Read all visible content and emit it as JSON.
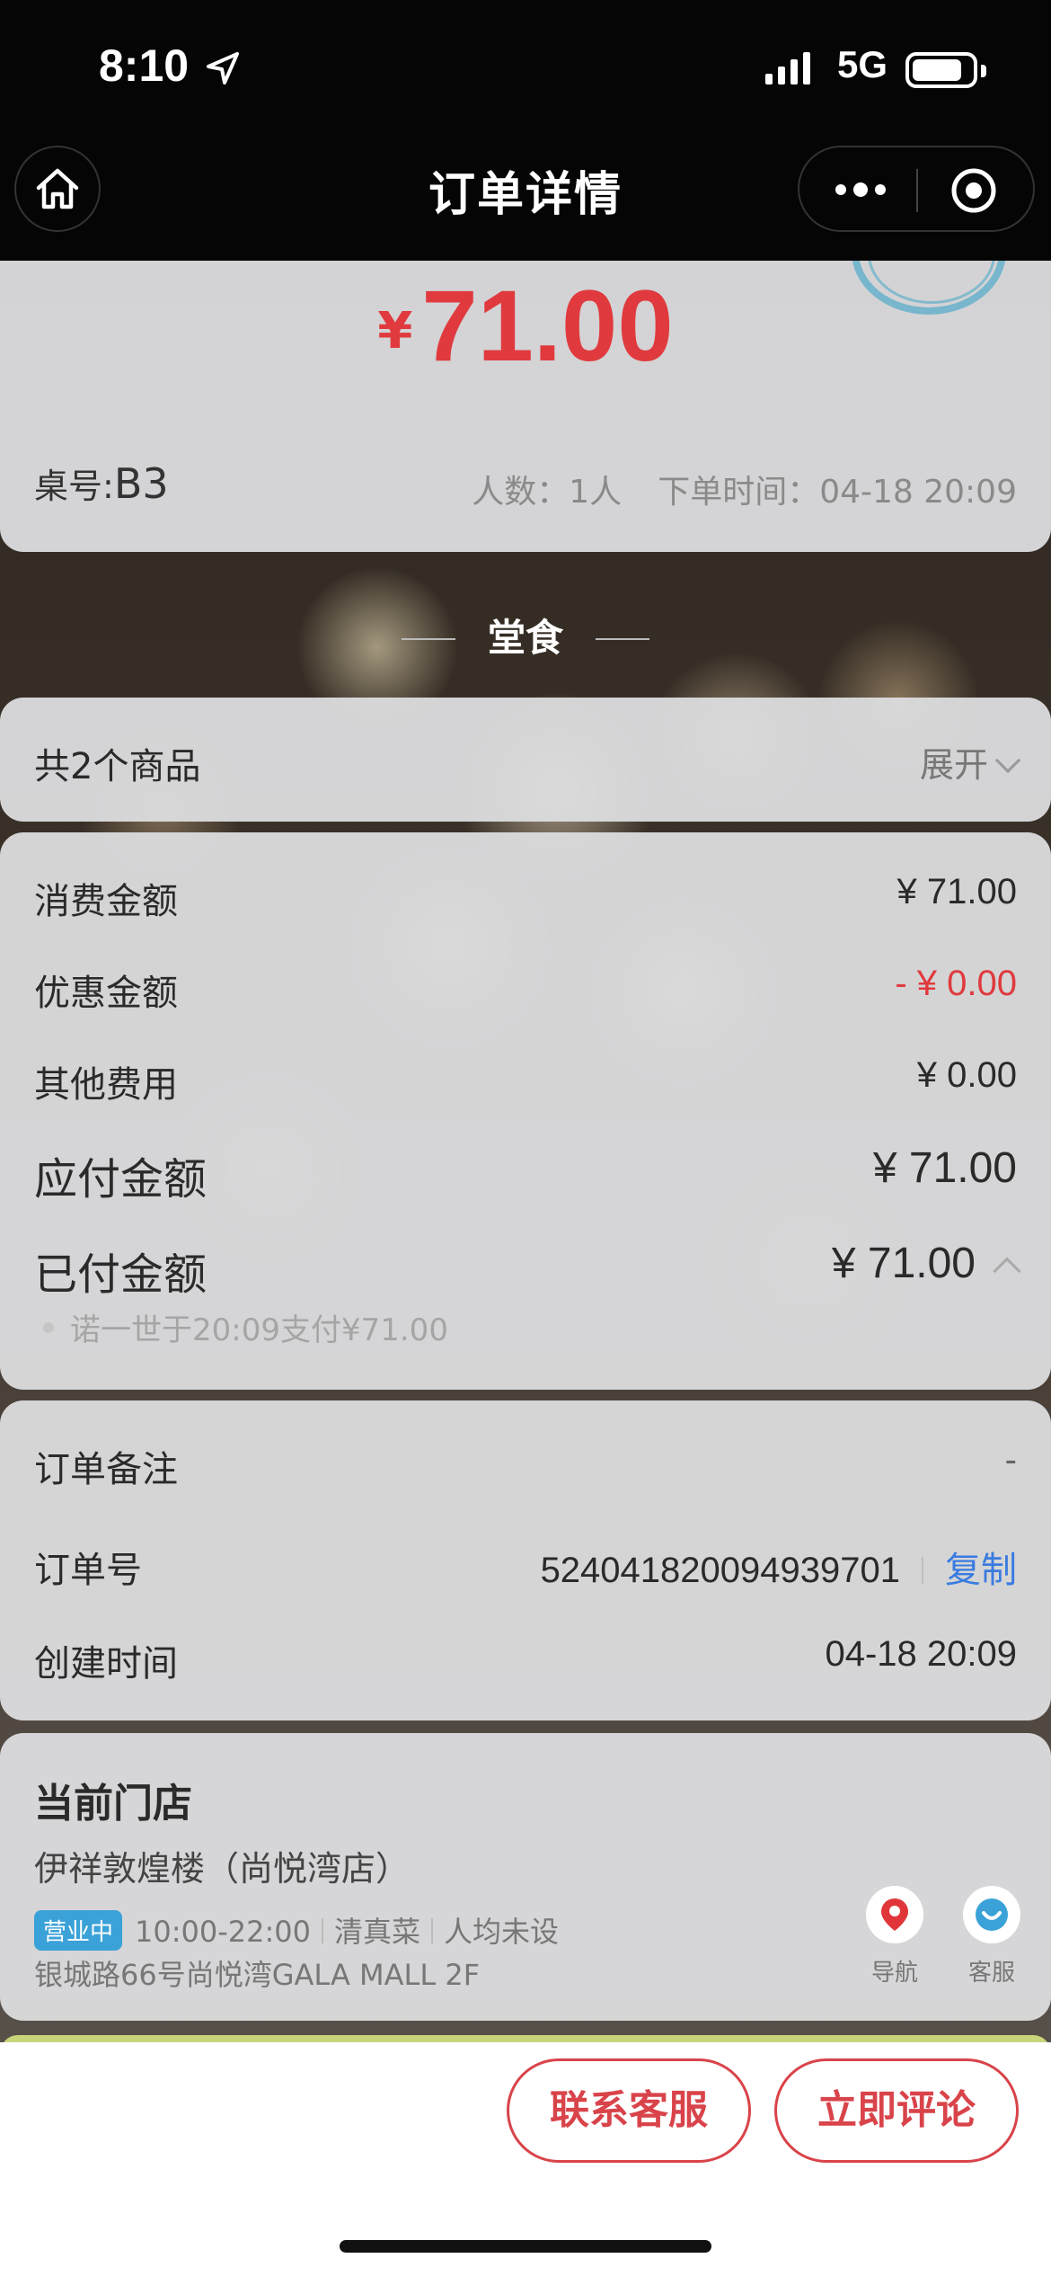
{
  "status_bar": {
    "time": "8:10",
    "network": "5G"
  },
  "nav": {
    "title": "订单详情"
  },
  "summary": {
    "currency": "¥",
    "amount": "71.00",
    "table_label": "桌号:",
    "table_no": "B3",
    "people": "人数：1人",
    "order_time": "下单时间：04-18 20:09"
  },
  "section": {
    "label": "堂食"
  },
  "items": {
    "count_label": "共2个商品",
    "expand_label": "展开"
  },
  "fees": {
    "consumption_label": "消费金额",
    "consumption_value": "¥ 71.00",
    "discount_label": "优惠金额",
    "discount_value": "- ¥ 0.00",
    "other_label": "其他费用",
    "other_value": "¥ 0.00",
    "payable_label": "应付金额",
    "payable_value": "¥ 71.00",
    "paid_label": "已付金额",
    "paid_value": "¥ 71.00",
    "paid_detail": "诺一世于20:09支付¥71.00"
  },
  "order": {
    "remark_label": "订单备注",
    "remark_value": "-",
    "no_label": "订单号",
    "no_value": "524041820094939701",
    "copy_label": "复制",
    "created_label": "创建时间",
    "created_value": "04-18 20:09"
  },
  "store": {
    "title": "当前门店",
    "name": "伊祥敦煌楼（尚悦湾店）",
    "status_badge": "营业中",
    "hours": "10:00-22:00",
    "cuisine": "清真菜",
    "avg_price": "人均未设",
    "address": "银城路66号尚悦湾GALA MALL 2F",
    "nav_label": "导航",
    "service_label": "客服"
  },
  "footer": {
    "contact_label": "联系客服",
    "review_label": "立即评论"
  },
  "colors": {
    "accent_red": "#e03a3e",
    "link_blue": "#3a7be0",
    "badge_blue": "#3aa2d8"
  }
}
